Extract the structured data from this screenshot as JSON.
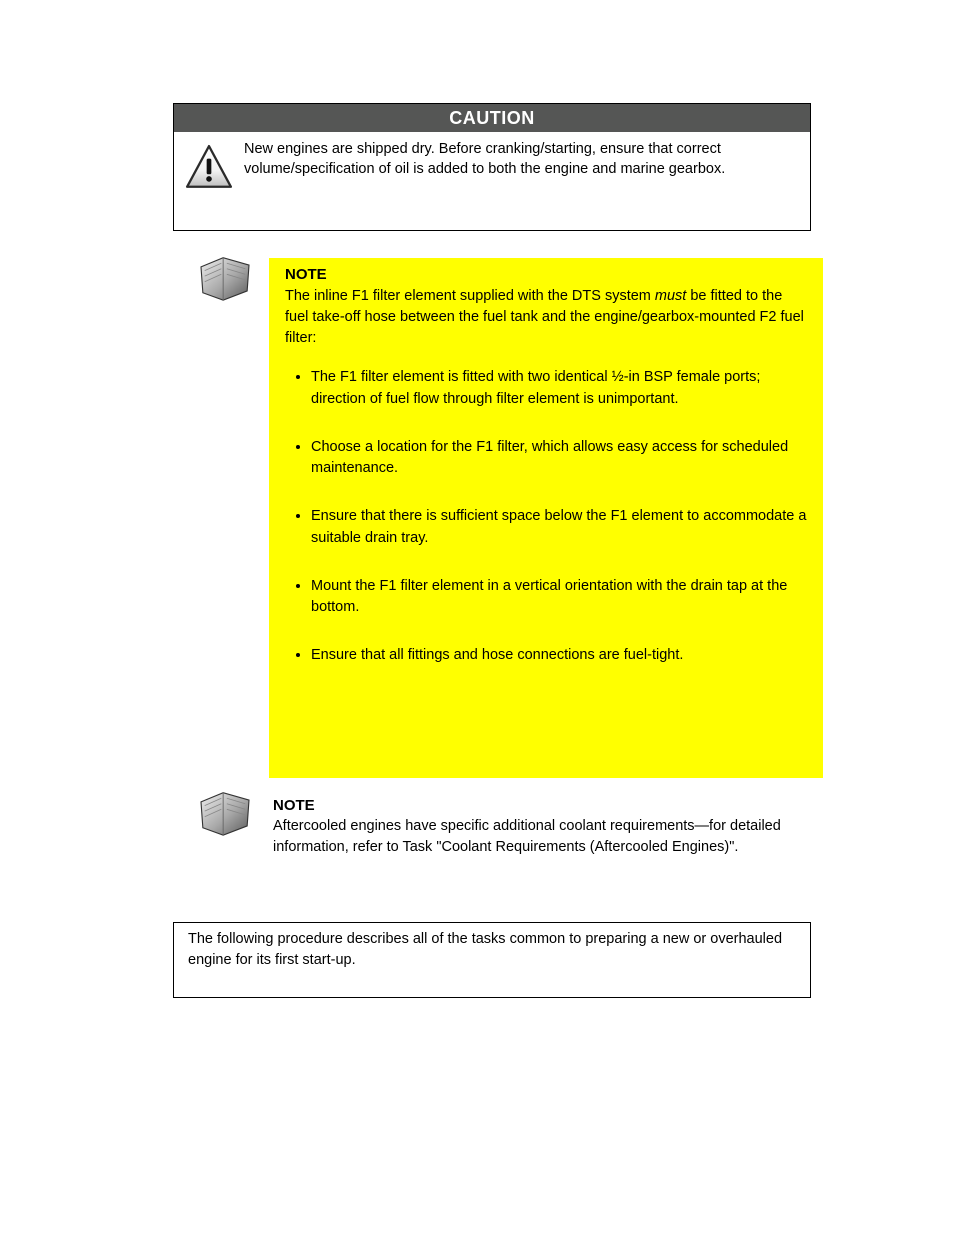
{
  "caution": {
    "title": "CAUTION",
    "text": "New engines are shipped dry. Before cranking/starting, ensure that correct volume/specification of oil is added to both the engine and marine gearbox."
  },
  "note1": {
    "title": "NOTE",
    "intro_plain": "The inline F1 filter element supplied with the DTS system ",
    "intro_italic": "must",
    "intro_tail": " be fitted to the fuel take-off hose between the fuel tank and the engine/gearbox-mounted F2 fuel filter:",
    "items": [
      "The F1 filter element is fitted with two identical ½-in BSP female ports; direction of fuel flow through filter element is unimportant.",
      "Choose a location for the F1 filter, which allows easy access for scheduled maintenance.",
      "Ensure that there is sufficient space below the F1 element to accommodate a suitable drain tray.",
      "Mount the F1 filter element in a vertical orientation with the drain tap at the bottom.",
      "Ensure that all fittings and hose connections are fuel-tight."
    ]
  },
  "note2": {
    "title": "NOTE",
    "text": "Aftercooled engines have specific additional coolant requirements—for detailed information, refer to Task \"Coolant Requirements (Aftercooled Engines)\"."
  },
  "outline": {
    "text": "The following procedure describes all of the tasks common to preparing a new or overhauled engine for its first start-up."
  }
}
